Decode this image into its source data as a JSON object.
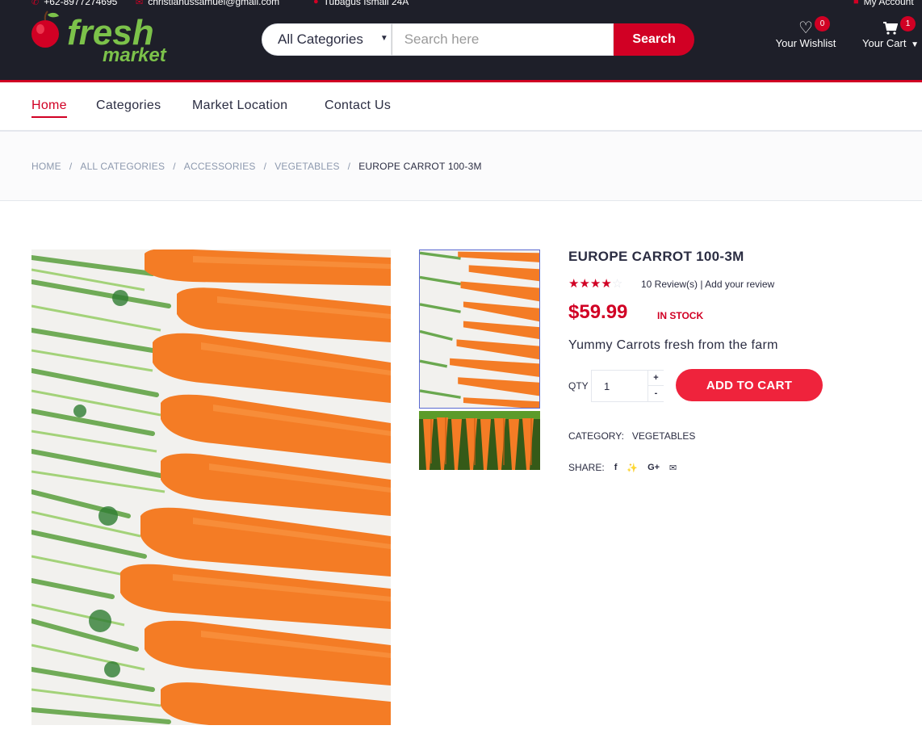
{
  "topbar": {
    "phone": "+62-8977274695",
    "email": "christianussamuel@gmail.com",
    "address": "Tubagus Ismail 24A",
    "account": "My Account"
  },
  "logo": {
    "word1": "fresh",
    "word2": "market"
  },
  "search": {
    "category": "All Categories",
    "placeholder": "Search here",
    "button": "Search"
  },
  "header": {
    "wishlist_label": "Your Wishlist",
    "wishlist_count": "0",
    "cart_label": "Your Cart",
    "cart_count": "1"
  },
  "nav": {
    "items": [
      "Home",
      "Categories",
      "Market Location",
      "Contact Us"
    ]
  },
  "breadcrumb": [
    "HOME",
    "ALL CATEGORIES",
    "ACCESSORIES",
    "VEGETABLES",
    "EUROPE CARROT 100-3M"
  ],
  "product": {
    "name": "EUROPE CARROT 100-3M",
    "rating": 4,
    "rating_max": 5,
    "reviews": "10 Review(s) | Add your review",
    "price": "$59.99",
    "stock": "IN STOCK",
    "description": "Yummy Carrots fresh from the farm",
    "qty_label": "QTY",
    "qty_value": "1",
    "add_to_cart": "ADD TO CART",
    "category_label": "CATEGORY:",
    "category_value": "VEGETABLES",
    "share_label": "SHARE:"
  },
  "colors": {
    "accent": "#d10024",
    "header_bg": "#1e1f29",
    "button": "#ef233c"
  }
}
